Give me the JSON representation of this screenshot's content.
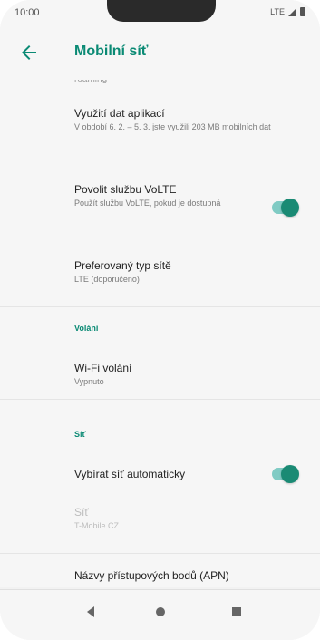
{
  "status_bar": {
    "time": "10:00",
    "network": "LTE"
  },
  "app_bar": {
    "title": "Mobilní síť"
  },
  "list": {
    "clipped_prev": "roaming",
    "items": [
      {
        "title": "Využití dat aplikací",
        "subtitle": "V období 6. 2. – 5. 3. jste využili 203 MB mobilních dat"
      },
      {
        "title": "Povolit službu VoLTE",
        "subtitle": "Použít službu VoLTE, pokud je dostupná",
        "toggle": true
      },
      {
        "title": "Preferovaný typ sítě",
        "subtitle": "LTE (doporučeno)"
      }
    ],
    "section_calls": "Volání",
    "wifi_calling": {
      "title": "Wi-Fi volání",
      "subtitle": "Vypnuto"
    },
    "section_network": "Síť",
    "auto_network": {
      "title": "Vybírat síť automaticky",
      "toggle": true
    },
    "network": {
      "title": "Síť",
      "subtitle": "T-Mobile CZ"
    },
    "apn": {
      "title": "Názvy přístupových bodů (APN)"
    }
  },
  "colors": {
    "accent": "#0a8a74",
    "toggle_track": "#80cbc4",
    "toggle_thumb": "#1a8a74"
  },
  "icons": {
    "back": "arrow-left-icon",
    "nav_back": "triangle-back-icon",
    "nav_home": "circle-home-icon",
    "nav_recents": "square-recents-icon"
  }
}
